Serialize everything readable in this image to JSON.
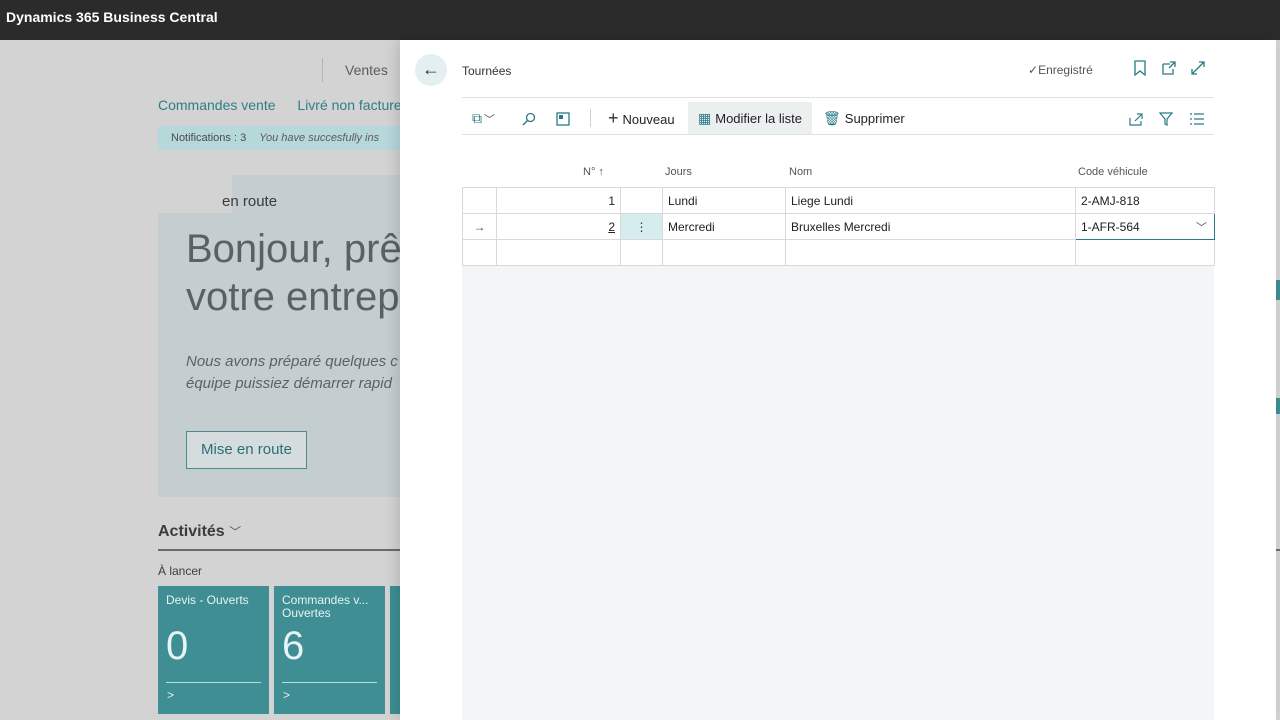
{
  "app": {
    "title": "Dynamics 365 Business Central"
  },
  "background": {
    "nav_top": "Ventes",
    "links": [
      "Commandes vente",
      "Livré non facture"
    ],
    "notification": {
      "label": "Notifications : 3",
      "message": "You have succesfully ins"
    },
    "hero": {
      "tab_label": "en route",
      "heading_line1": "Bonjour, prê",
      "heading_line2": "votre entrep",
      "text_line1": "Nous avons préparé quelques c",
      "text_line2": "équipe puissiez démarrer rapid",
      "button": "Mise en route"
    },
    "activities": {
      "title": "Activités",
      "subtitle": "À lancer"
    },
    "tiles": [
      {
        "label": "Devis - Ouverts",
        "value": "0",
        "arrow": ">"
      },
      {
        "label": "Commandes v... Ouvertes",
        "value": "6",
        "arrow": ">"
      }
    ]
  },
  "panel": {
    "title": "Tournées",
    "status": "Enregistré",
    "toolbar": {
      "new": "Nouveau",
      "edit_list": "Modifier la liste",
      "delete": "Supprimer"
    },
    "columns": {
      "no": "N° ↑",
      "jours": "Jours",
      "nom": "Nom",
      "vehicule": "Code véhicule"
    },
    "rows": [
      {
        "indicator": "",
        "no": "1",
        "jours": "Lundi",
        "nom": "Liege Lundi",
        "vehicule": "2-AMJ-818"
      },
      {
        "indicator": "→",
        "no": "2",
        "jours": "Mercredi",
        "nom": "Bruxelles Mercredi",
        "vehicule": "1-AFR-564"
      }
    ]
  }
}
